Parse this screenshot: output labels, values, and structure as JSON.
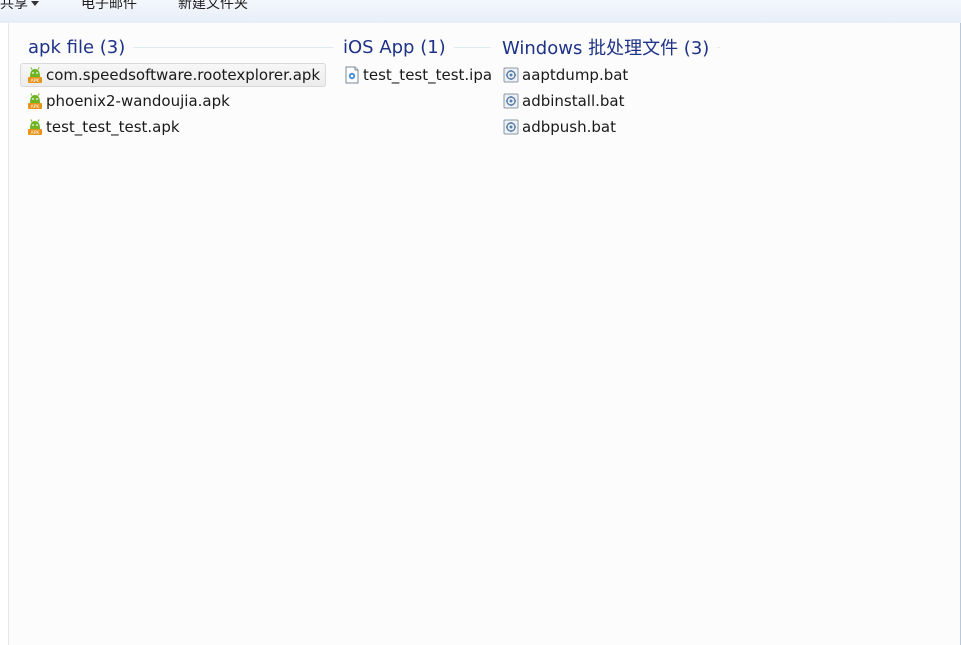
{
  "toolbar": {
    "share_label": "共享",
    "email_label": "电子邮件",
    "new_folder_label": "新建文件夹"
  },
  "groups": [
    {
      "title": "apk file (3)",
      "items": [
        {
          "label": "com.speedsoftware.rootexplorer.apk",
          "icon": "android-apk-icon",
          "hover": true
        },
        {
          "label": "phoenix2-wandoujia.apk",
          "icon": "android-apk-icon"
        },
        {
          "label": "test_test_test.apk",
          "icon": "android-apk-icon"
        }
      ]
    },
    {
      "title": "iOS App (1)",
      "items": [
        {
          "label": "test_test_test.ipa",
          "icon": "ipa-file-icon"
        }
      ]
    },
    {
      "title": "Windows 批处理文件 (3)",
      "items": [
        {
          "label": "aaptdump.bat",
          "icon": "batch-file-icon"
        },
        {
          "label": "adbinstall.bat",
          "icon": "batch-file-icon"
        },
        {
          "label": "adbpush.bat",
          "icon": "batch-file-icon"
        }
      ]
    }
  ],
  "colors": {
    "group_title": "#1e3287",
    "text": "#1a1a1a",
    "apk_green": "#6fb523",
    "apk_orange": "#e8941a"
  }
}
